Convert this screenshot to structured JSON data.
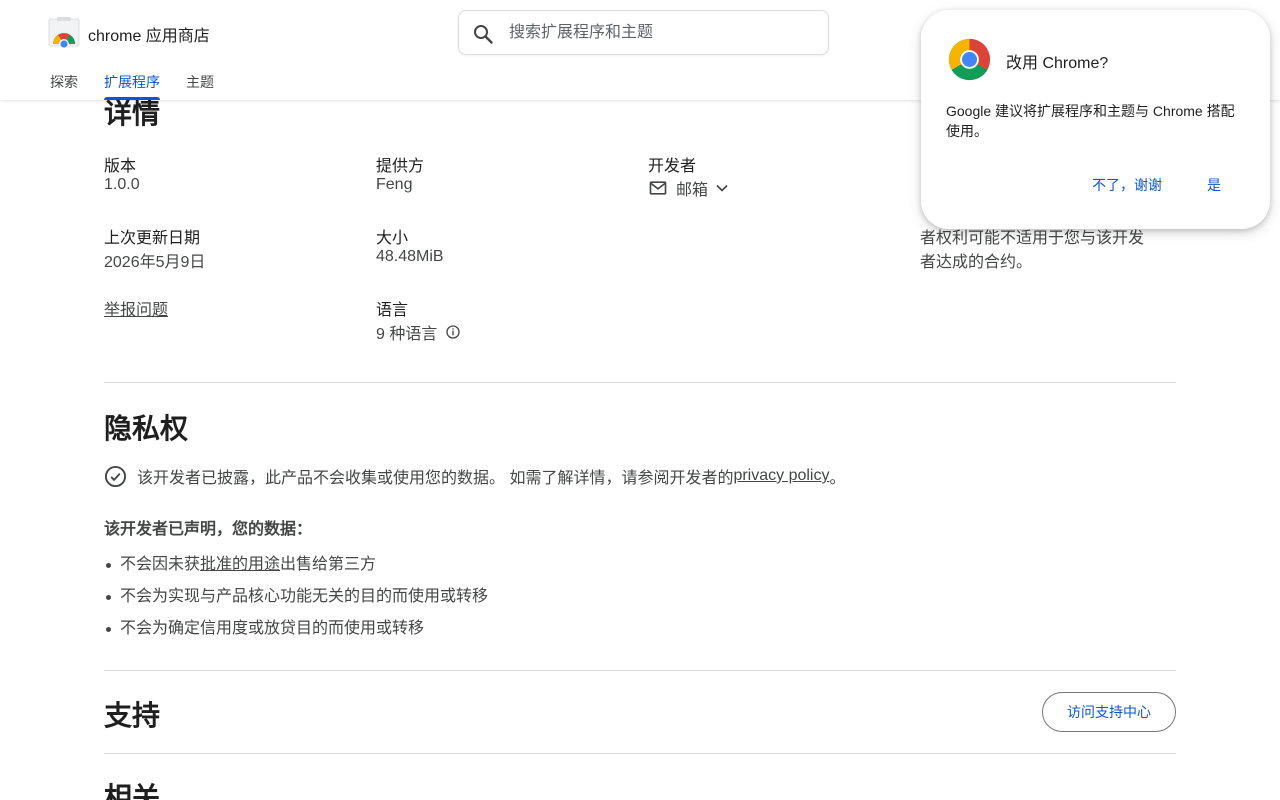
{
  "header": {
    "brand": "chrome 应用商店",
    "search_placeholder": "搜索扩展程序和主题",
    "tabs": [
      {
        "label": "探索",
        "active": false
      },
      {
        "label": "扩展程序",
        "active": true
      },
      {
        "label": "主题",
        "active": false
      }
    ]
  },
  "details": {
    "title": "详情",
    "version_label": "版本",
    "version_value": "1.0.0",
    "provider_label": "提供方",
    "provider_value": "Feng",
    "developer_label": "开发者",
    "developer_email": "邮箱",
    "updated_label": "上次更新日期",
    "updated_value": "2026年5月9日",
    "size_label": "大小",
    "size_value": "48.48MiB",
    "report_link": "举报问题",
    "language_label": "语言",
    "language_value": "9 种语言",
    "trader_note_line1": "者权利可能不适用于您与该开发",
    "trader_note_line2": "者达成的合约。"
  },
  "privacy": {
    "title": "隐私权",
    "statement_prefix": "该开发者已披露，此产品不会收集或使用您的数据。 如需了解详情，请参阅开发者的",
    "policy_link": "privacy policy",
    "statement_suffix": "。",
    "declared_heading": "该开发者已声明，您的数据：",
    "bullet1_prefix": "不会因未获",
    "bullet1_link": "批准的用途",
    "bullet1_suffix": "出售给第三方",
    "bullet2": "不会为实现与产品核心功能无关的目的而使用或转移",
    "bullet3": "不会为确定信用度或放贷目的而使用或转移"
  },
  "support": {
    "title": "支持",
    "button_label": "访问支持中心"
  },
  "related": {
    "title": "相关"
  },
  "popup": {
    "title": "改用 Chrome?",
    "body": "Google 建议将扩展程序和主题与 Chrome 搭配使用。",
    "decline_label": "不了，谢谢",
    "accept_label": "是"
  },
  "colors": {
    "accent": "#0b57d0",
    "text_primary": "#1f1f1f",
    "text_secondary": "#444746",
    "divider": "#dadce0"
  }
}
